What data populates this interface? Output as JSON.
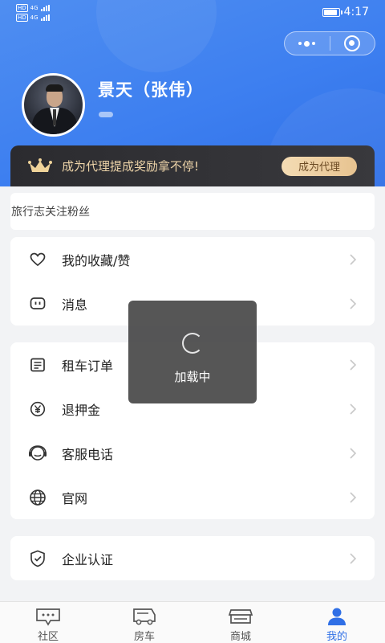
{
  "status_bar": {
    "sim1_tag": "HD",
    "sim1_net": "4G",
    "sim2_tag": "HD",
    "sim2_net": "4G",
    "battery_level": 0.9,
    "time": "4:17"
  },
  "profile": {
    "name": "景天（张伟）"
  },
  "vip_banner": {
    "text": "成为代理提成奖励拿不停!",
    "button_label": "成为代理"
  },
  "stats": {
    "text": "旅行志关注粉丝"
  },
  "menu_group_1": [
    {
      "label": "我的收藏/赞",
      "icon": "heart-icon"
    },
    {
      "label": "消息",
      "icon": "message-icon"
    }
  ],
  "menu_group_2": [
    {
      "label": "租车订单",
      "icon": "order-list-icon"
    },
    {
      "label": "退押金",
      "icon": "yen-icon"
    },
    {
      "label": "客服电话",
      "icon": "headset-icon"
    },
    {
      "label": "官网",
      "icon": "globe-icon"
    }
  ],
  "menu_group_3": [
    {
      "label": "企业认证",
      "icon": "shield-check-icon"
    }
  ],
  "loading_toast": {
    "text": "加载中"
  },
  "tabbar": [
    {
      "label": "社区",
      "icon": "chat-icon",
      "active": false
    },
    {
      "label": "房车",
      "icon": "rv-icon",
      "active": false
    },
    {
      "label": "商城",
      "icon": "shop-icon",
      "active": false
    },
    {
      "label": "我的",
      "icon": "user-icon",
      "active": true
    }
  ],
  "colors": {
    "accent": "#2f6fe6",
    "header_blue": "#3d7ff0",
    "vip_gold": "#ecd3a8",
    "vip_dark": "#2b2b2f"
  }
}
